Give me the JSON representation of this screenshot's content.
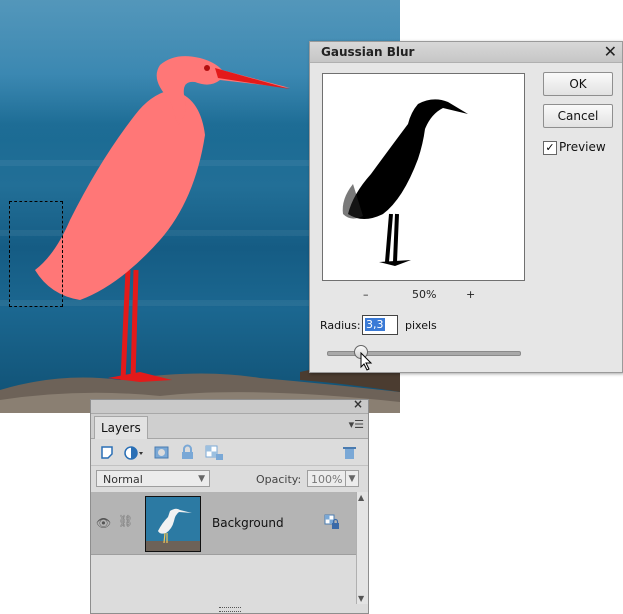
{
  "dialog": {
    "title": "Gaussian Blur",
    "ok_label": "OK",
    "cancel_label": "Cancel",
    "preview_label": "Preview",
    "preview_checked": true,
    "zoom_out_label": "–",
    "zoom_level": "50%",
    "zoom_in_label": "+",
    "radius_label": "Radius:",
    "radius_value": "3,3",
    "units_label": "pixels"
  },
  "layers_panel": {
    "tab_label": "Layers",
    "blend_mode": "Normal",
    "opacity_label": "Opacity:",
    "opacity_value": "100%",
    "layers": [
      {
        "name": "Background",
        "visible": true,
        "locked": true
      }
    ]
  },
  "icons": [
    "new-layer-icon",
    "adjustment-layer-icon",
    "layer-mask-icon",
    "lock-all-icon",
    "lock-transparency-icon",
    "trash-icon",
    "eye-icon",
    "link-icon",
    "panel-menu-icon",
    "close-icon"
  ],
  "colors": {
    "selection_highlight": "#ff7a7a",
    "water": "#1a6a93",
    "accent": "#3a7ad6"
  }
}
